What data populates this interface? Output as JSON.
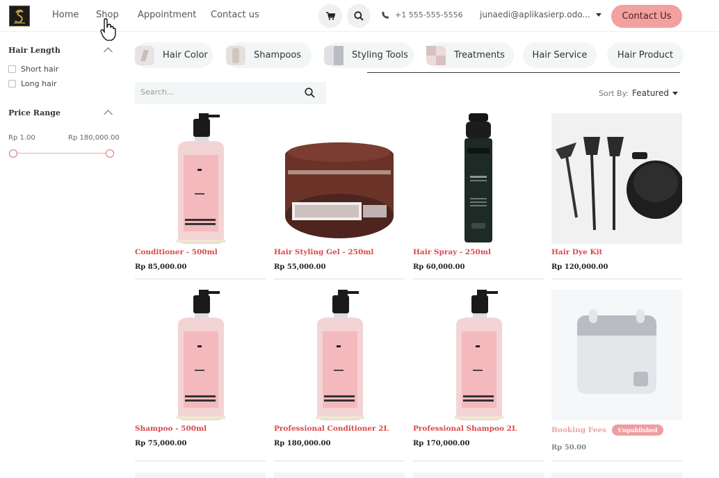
{
  "header": {
    "logo_icon": "salon-logo-icon",
    "nav": [
      "Home",
      "Shop",
      "Appointment",
      "Contact us"
    ],
    "phone": "+1 555-555-5556",
    "email": "junaedi@aplikasierp.odo...",
    "contact_button": "Contact Us",
    "accent": "#f2a0a0"
  },
  "sidebar": {
    "hair_length": {
      "title": "Hair Length",
      "options": [
        "Short hair",
        "Long hair"
      ]
    },
    "price_range": {
      "title": "Price Range",
      "min": "Rp 1.00",
      "max": "Rp 180,000.00"
    }
  },
  "categories": [
    "Hair Color",
    "Shampoos",
    "Styling Tools",
    "Treatments",
    "Hair Service",
    "Hair Product"
  ],
  "toolbar": {
    "search_placeholder": "Search...",
    "sort_label": "Sort By:",
    "sort_value": "Featured"
  },
  "products": [
    {
      "name": "Conditioner - 500ml",
      "price": "Rp 85,000.00",
      "image": "pink-bottle"
    },
    {
      "name": "Hair Styling Gel - 250ml",
      "price": "Rp 55,000.00",
      "image": "pomade-jar"
    },
    {
      "name": "Hair Spray - 250ml",
      "price": "Rp 60,000.00",
      "image": "spray-can"
    },
    {
      "name": "Hair Dye Kit",
      "price": "Rp 120,000.00",
      "image": "dye-kit"
    },
    {
      "name": "Shampoo - 500ml",
      "price": "Rp 75,000.00",
      "image": "pink-bottle"
    },
    {
      "name": "Professional Conditioner 2L",
      "price": "Rp 180,000.00",
      "image": "pink-bottle"
    },
    {
      "name": "Professional Shampoo 2L",
      "price": "Rp 170,000.00",
      "image": "pink-bottle"
    },
    {
      "name": "Booking Fees",
      "price": "Rp 50.00",
      "image": "calendar-placeholder",
      "badge": "Unpublished"
    }
  ]
}
